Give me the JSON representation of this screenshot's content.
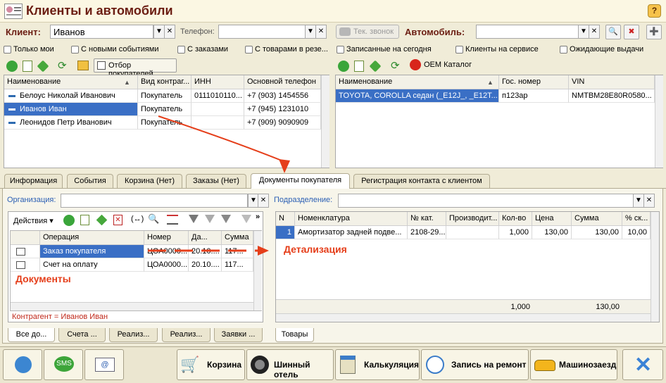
{
  "window": {
    "title": "Клиенты и автомобили",
    "help": "?"
  },
  "client": {
    "label": "Клиент:",
    "value": "Иванов",
    "phone_label": "Телефон:",
    "phone_value": "",
    "call_button": "Тек. звонок",
    "filters": [
      "Только мои",
      "С новыми событиями",
      "С заказами",
      "С товарами в резе..."
    ],
    "toolbar": {
      "select_buyers": "Отбор покупателей"
    },
    "columns": [
      "Наименование",
      "Вид контраг...",
      "ИНН",
      "Основной телефон"
    ],
    "rows": [
      {
        "name": "Белоус Николай Иванович",
        "type": "Покупатель",
        "inn": "0111010110...",
        "phone": "+7 (903) 1454556"
      },
      {
        "name": "Иванов Иван",
        "type": "Покупатель",
        "inn": "",
        "phone": "+7 (945) 1231010"
      },
      {
        "name": "Леонидов Петр Иванович",
        "type": "Покупатель",
        "inn": "",
        "phone": "+7 (909) 9090909"
      }
    ]
  },
  "car": {
    "label": "Автомобиль:",
    "value": "",
    "filters": [
      "Записанные на сегодня",
      "Клиенты на сервисе",
      "Ожидающие выдачи"
    ],
    "toolbar": {
      "oem": "OEM Каталог"
    },
    "columns": [
      "Наименование",
      "Гос. номер",
      "VIN"
    ],
    "rows": [
      {
        "name": "TOYOTA, COROLLA седан (_E12J_, _E12T...",
        "plate": "п123ар",
        "vin": "NMTBM28E80R0580..."
      }
    ]
  },
  "tabs": [
    "Информация",
    "События",
    "Корзина (Нет)",
    "Заказы (Нет)",
    "Документы покупателя",
    "Регистрация контакта с клиентом"
  ],
  "docs": {
    "org_label": "Организация:",
    "org_value": "",
    "dept_label": "Подразделение:",
    "dept_value": "",
    "actions": "Действия",
    "columns": [
      "Операция",
      "Номер",
      "Да...",
      "Сумма"
    ],
    "rows": [
      {
        "op": "Заказ покупателя",
        "num": "ЦОА0000...",
        "date": "20.10....",
        "sum": "117..."
      },
      {
        "op": "Счет на оплату",
        "num": "ЦОА0000...",
        "date": "20.10....",
        "sum": "117..."
      }
    ],
    "annotation": "Документы",
    "filter_text": "Контрагент = Иванов Иван",
    "bottom_tabs": [
      "Все до...",
      "Счета ...",
      "Реализ...",
      "Реализ...",
      "Заявки ..."
    ]
  },
  "detail": {
    "annotation": "Детализация",
    "columns": [
      "N",
      "Номенклатура",
      "№ кат.",
      "Производит...",
      "Кол-во",
      "Цена",
      "Сумма",
      "% ск..."
    ],
    "rows": [
      {
        "n": "1",
        "item": "Амортизатор задней подве...",
        "cat": "2108-29...",
        "maker": "",
        "qty": "1,000",
        "price": "130,00",
        "sum": "130,00",
        "disc": "10,00"
      }
    ],
    "totals": {
      "qty": "1,000",
      "sum": "130,00"
    },
    "bottom_tabs": [
      "Товары"
    ]
  },
  "bottom_buttons": [
    "Корзина",
    "Шинный отель",
    "Калькуляция",
    "Запись на ремонт",
    "Машинозаезд"
  ],
  "colors": {
    "title": "#6b1d12",
    "selection": "#3a6fc5",
    "annotation": "#e53e1a",
    "tab_bar": "#ebe6d0"
  }
}
